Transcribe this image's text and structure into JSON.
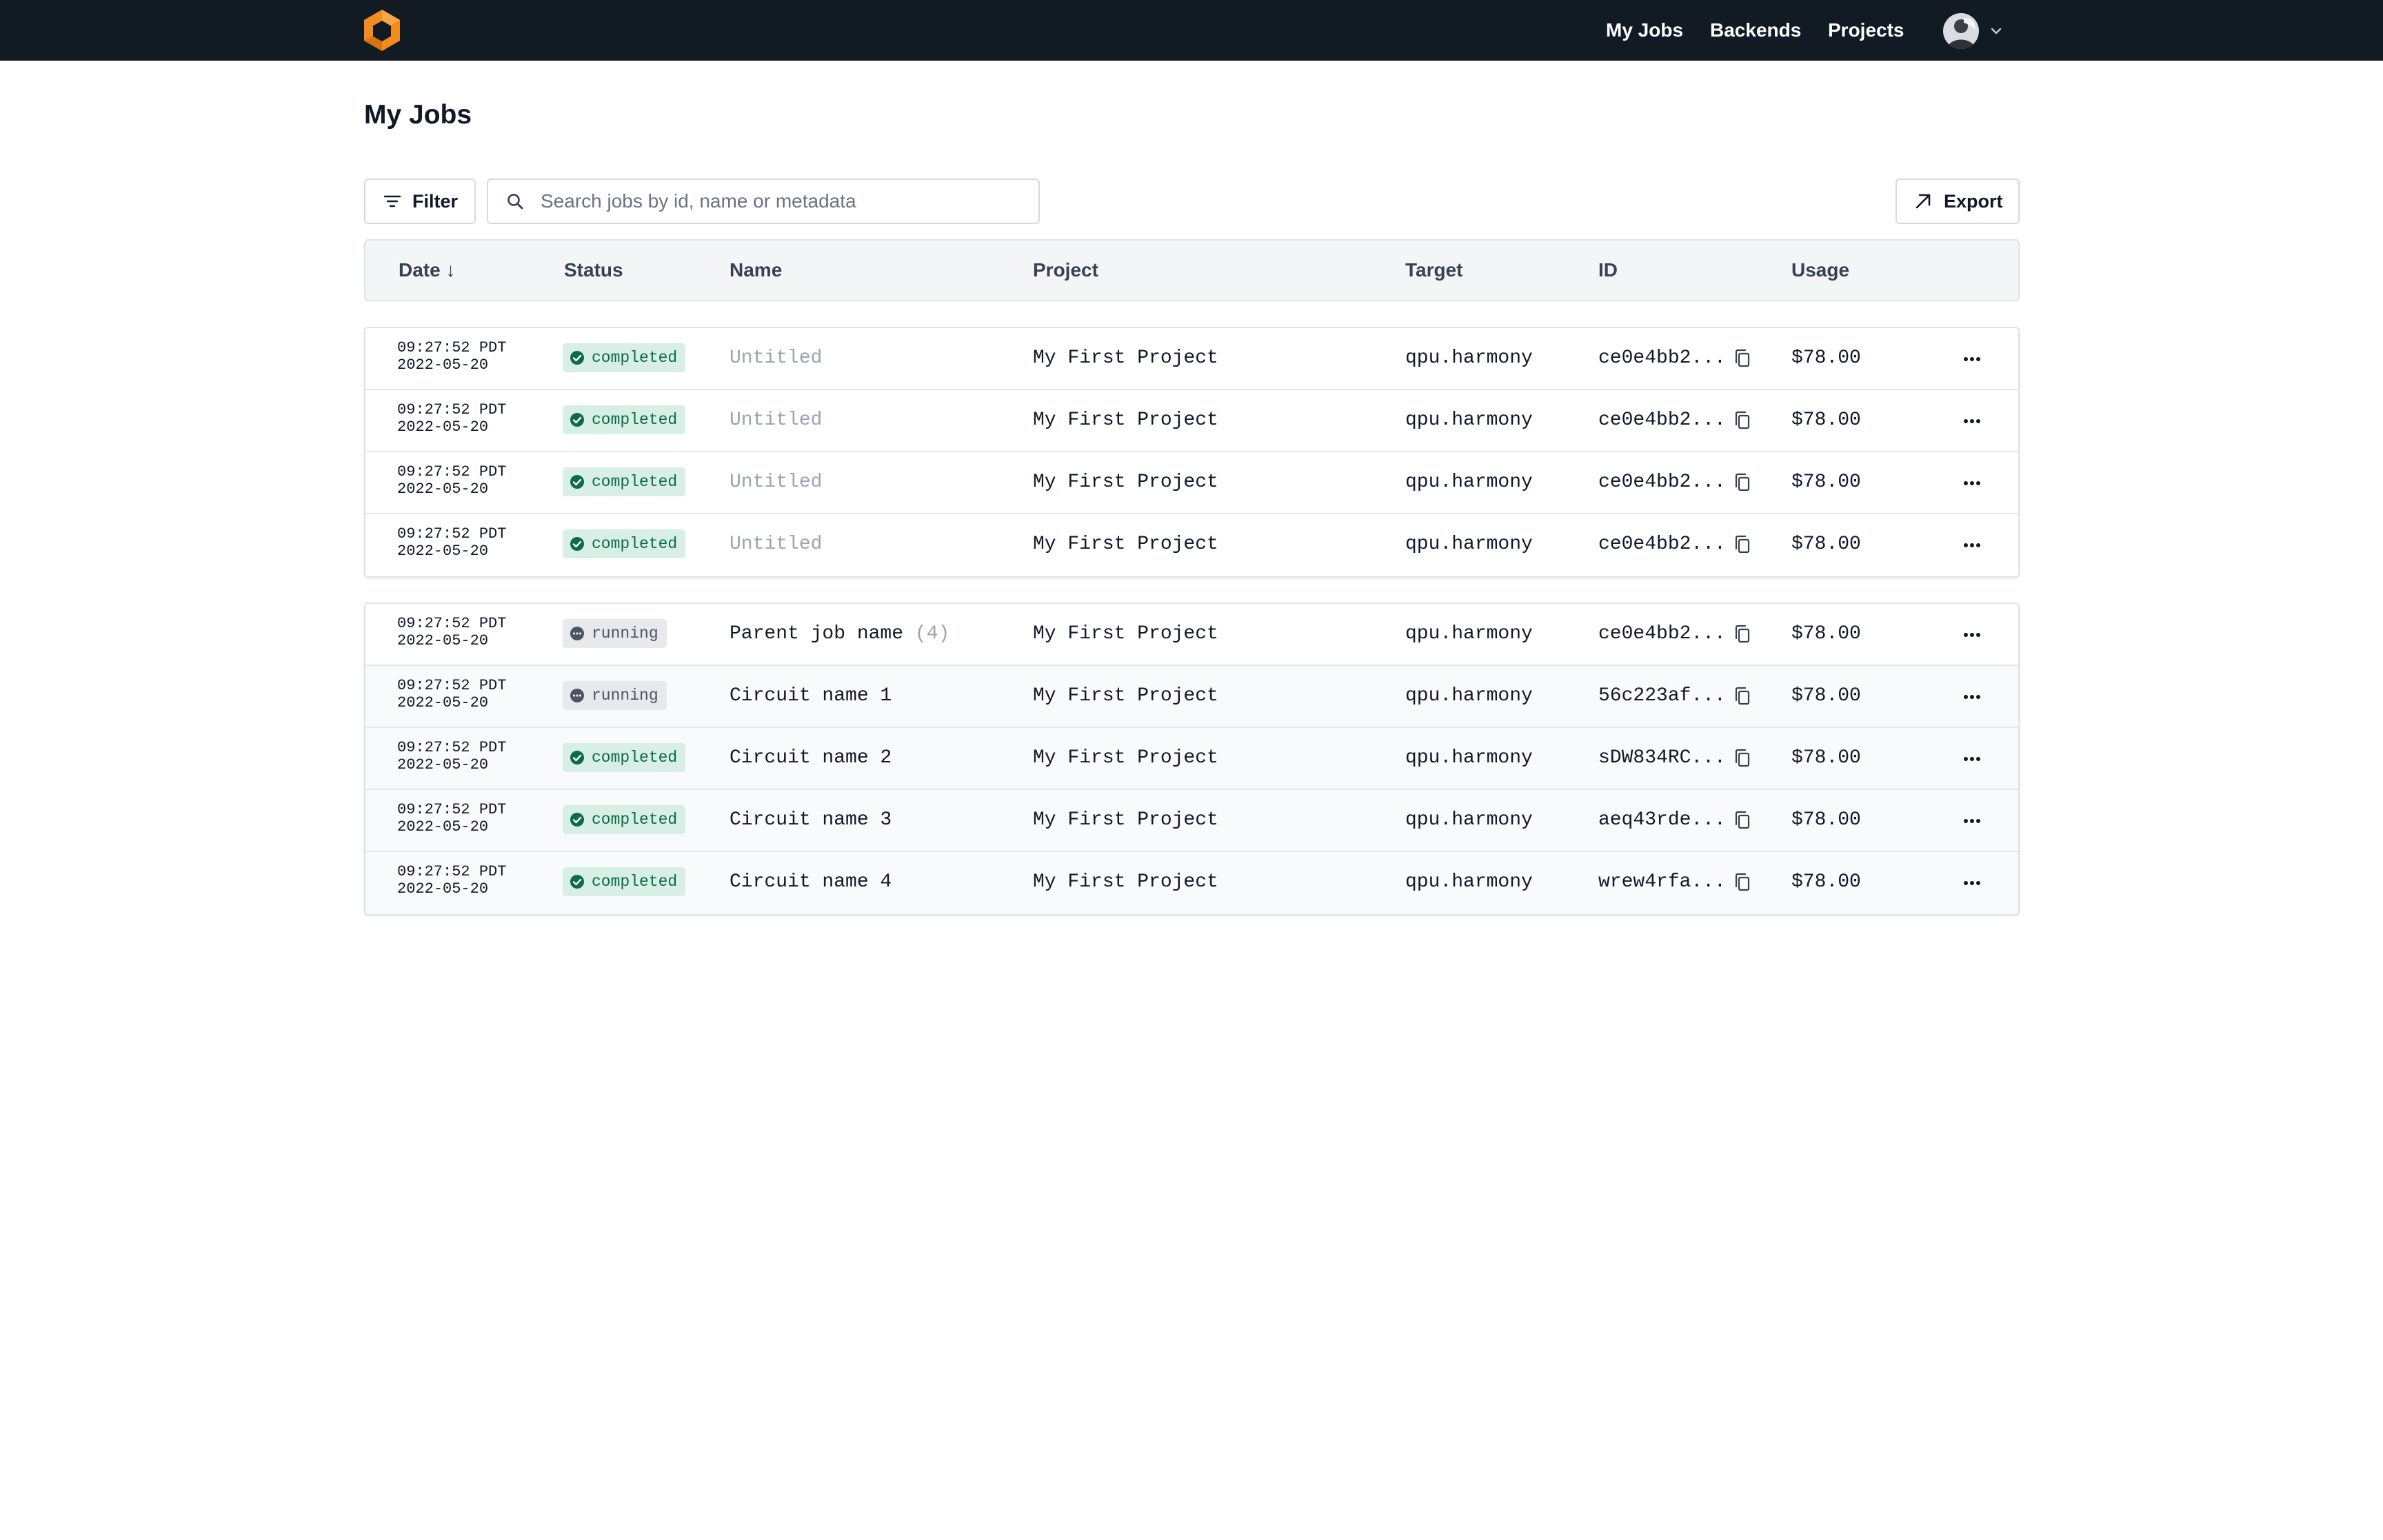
{
  "nav": {
    "links": [
      "My Jobs",
      "Backends",
      "Projects"
    ]
  },
  "page": {
    "title": "My Jobs"
  },
  "toolbar": {
    "filter_label": "Filter",
    "search_placeholder": "Search jobs by id, name or metadata",
    "search_value": "",
    "export_label": "Export"
  },
  "table": {
    "columns": [
      "Date ↓",
      "Status",
      "Name",
      "Project",
      "Target",
      "ID",
      "Usage"
    ],
    "group1": [
      {
        "time": "09:27:52 PDT",
        "date": "2022-05-20",
        "status": "completed",
        "name": "Untitled",
        "project": "My First Project",
        "target": "qpu.harmony",
        "id": "ce0e4bb2...",
        "usage": "$78.00"
      },
      {
        "time": "09:27:52 PDT",
        "date": "2022-05-20",
        "status": "completed",
        "name": "Untitled",
        "project": "My First Project",
        "target": "qpu.harmony",
        "id": "ce0e4bb2...",
        "usage": "$78.00"
      },
      {
        "time": "09:27:52 PDT",
        "date": "2022-05-20",
        "status": "completed",
        "name": "Untitled",
        "project": "My First Project",
        "target": "qpu.harmony",
        "id": "ce0e4bb2...",
        "usage": "$78.00"
      },
      {
        "time": "09:27:52 PDT",
        "date": "2022-05-20",
        "status": "completed",
        "name": "Untitled",
        "project": "My First Project",
        "target": "qpu.harmony",
        "id": "ce0e4bb2...",
        "usage": "$78.00"
      }
    ],
    "group2": [
      {
        "time": "09:27:52 PDT",
        "date": "2022-05-20",
        "status": "running",
        "name": "Parent job name",
        "count": "(4)",
        "project": "My First Project",
        "target": "qpu.harmony",
        "id": "ce0e4bb2...",
        "usage": "$78.00"
      },
      {
        "time": "09:27:52 PDT",
        "date": "2022-05-20",
        "status": "running",
        "name": "Circuit name 1",
        "project": "My First Project",
        "target": "qpu.harmony",
        "id": "56c223af...",
        "usage": "$78.00"
      },
      {
        "time": "09:27:52 PDT",
        "date": "2022-05-20",
        "status": "completed",
        "name": "Circuit name 2",
        "project": "My First Project",
        "target": "qpu.harmony",
        "id": "sDW834RC...",
        "usage": "$78.00"
      },
      {
        "time": "09:27:52 PDT",
        "date": "2022-05-20",
        "status": "completed",
        "name": "Circuit name 3",
        "project": "My First Project",
        "target": "qpu.harmony",
        "id": "aeq43rde...",
        "usage": "$78.00"
      },
      {
        "time": "09:27:52 PDT",
        "date": "2022-05-20",
        "status": "completed",
        "name": "Circuit name 4",
        "project": "My First Project",
        "target": "qpu.harmony",
        "id": "wrew4rfa...",
        "usage": "$78.00"
      }
    ]
  },
  "icons": {
    "logo": "hexagon-logo-icon",
    "filter": "filter-lines-icon",
    "search": "search-icon",
    "export": "arrow-up-right-icon",
    "copy": "copy-icon",
    "more": "more-horizontal-icon",
    "completed": "check-circle-icon",
    "running": "dots-circle-icon",
    "avatar_menu": "chevron-down-icon"
  },
  "colors": {
    "nav_bg": "#121a24",
    "completed_bg": "#d7efe4",
    "completed_fg": "#0b6b4b",
    "running_bg": "#e8e9ec",
    "running_fg": "#4b5563",
    "logo_orange": "#f28c1e"
  }
}
